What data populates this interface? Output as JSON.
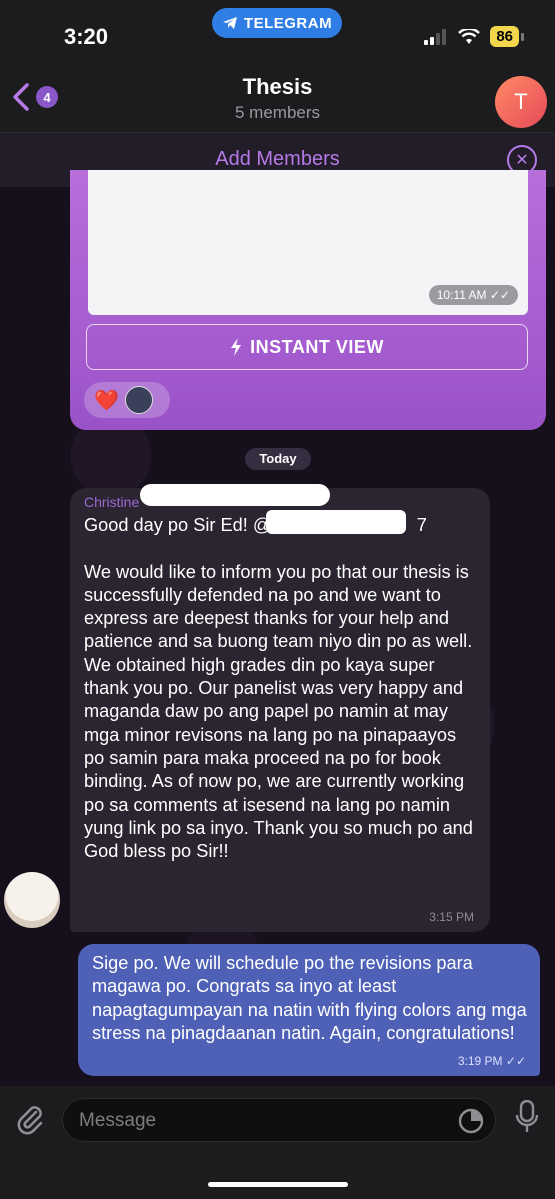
{
  "status_bar": {
    "time": "3:20",
    "app_pill": "TELEGRAM",
    "battery": "86"
  },
  "header": {
    "back_count": "4",
    "title": "Thesis",
    "subtitle": "5 members",
    "avatar_letter": "T"
  },
  "banner": {
    "add_members_label": "Add Members"
  },
  "messages": {
    "link_preview_time": "10:11 AM",
    "instant_view_label": "INSTANT VIEW",
    "reaction": "❤️",
    "day_separator": "Today",
    "incoming": {
      "sender": "Christine",
      "text": "Good day po Sir Ed! @        7\n\nWe would like to inform you po that our thesis is successfully defended na po and we want to express are deepest thanks for your help and patience and sa buong team niyo din po as well. We obtained high grades din po kaya super thank you po. Our panelist was very happy and maganda daw po ang papel po namin at may mga minor revisons na lang po na pinapaayos po samin para maka proceed na po for book binding. As of now po, we are currently working po sa comments at isesend na lang po namin yung link po sa inyo. Thank you so much po and God bless po Sir!!",
      "time": "3:15 PM"
    },
    "outgoing": {
      "text": "Sige po. We will schedule po the revisions para magawa po. Congrats sa inyo at least napagtagumpayan na natin with flying colors ang mga stress na pinagdaanan natin. Again, congratulations!",
      "time": "3:19 PM"
    }
  },
  "input": {
    "placeholder": "Message"
  },
  "colors": {
    "accent": "#b57ae8",
    "outgoing_bubble": "#4f61b7",
    "incoming_bubble": "#2b2531",
    "telegram_blue": "#2f7ee6"
  }
}
